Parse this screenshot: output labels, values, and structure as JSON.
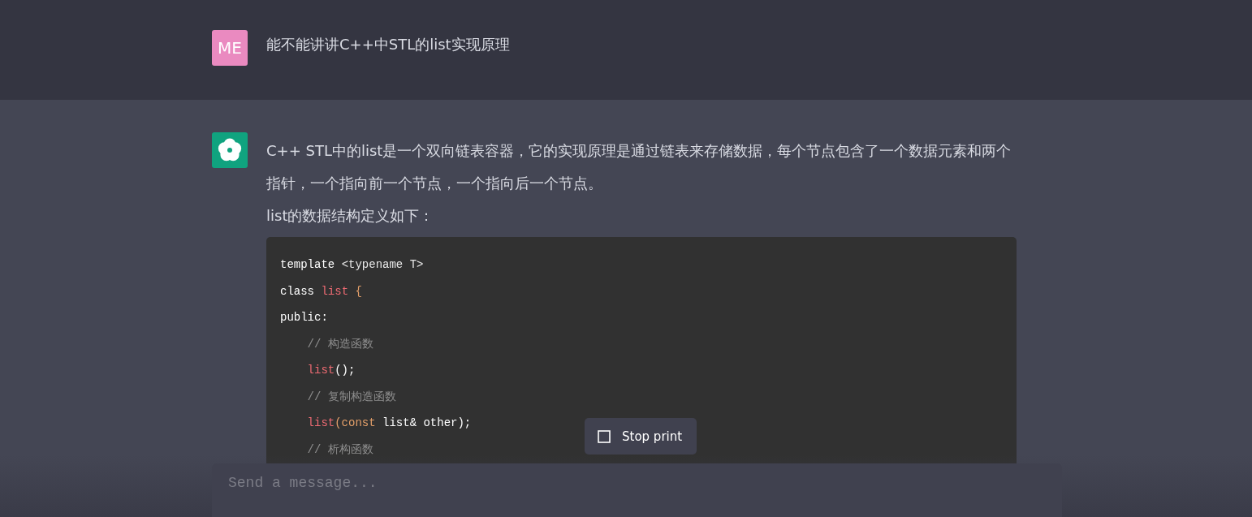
{
  "conversation": [
    {
      "kind": "user",
      "avatar": "ME",
      "text": "能不能讲讲C++中STL的list实现原理"
    },
    {
      "kind": "assistant",
      "paragraphs": [
        "C++ STL中的list是一个双向链表容器，它的实现原理是通过链表来存储数据，每个节点包含了一个数据元素和两个指针，一个指向前一个节点，一个指向后一个节点。",
        "list的数据结构定义如下："
      ],
      "code": [
        [
          {
            "kind": "plain",
            "text": "template "
          },
          {
            "kind": "type",
            "text": "<typename T>"
          }
        ],
        [
          {
            "kind": "plain",
            "text": "class "
          },
          {
            "kind": "name",
            "text": "list"
          },
          {
            "kind": "punct",
            "text": " {"
          }
        ],
        [
          {
            "kind": "plain",
            "text": "public:"
          }
        ],
        [
          {
            "kind": "comment",
            "text": "    // 构造函数"
          }
        ],
        [
          {
            "kind": "name",
            "text": "    list"
          },
          {
            "kind": "plain",
            "text": "();"
          }
        ],
        [
          {
            "kind": "comment",
            "text": "    // 复制构造函数"
          }
        ],
        [
          {
            "kind": "name",
            "text": "    list"
          },
          {
            "kind": "keyword",
            "text": "(const"
          },
          {
            "kind": "plain",
            "text": " list& other);"
          }
        ],
        [
          {
            "kind": "comment",
            "text": "    // 析构函数"
          }
        ]
      ]
    }
  ],
  "stop_button": {
    "label": "Stop print"
  },
  "composer": {
    "placeholder": "Send a message..."
  }
}
